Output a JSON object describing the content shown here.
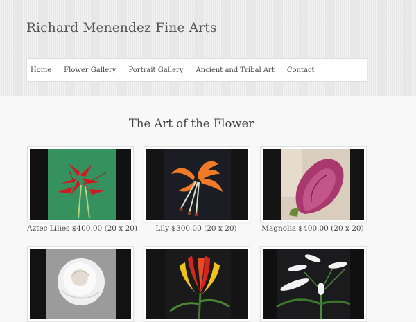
{
  "site": {
    "title": "Richard Menendez Fine Arts"
  },
  "nav": {
    "items": [
      {
        "label": "Home"
      },
      {
        "label": "Flower Gallery"
      },
      {
        "label": "Portrait Gallery"
      },
      {
        "label": "Ancient and Tribal Art"
      },
      {
        "label": "Contact"
      }
    ]
  },
  "page": {
    "heading": "The Art of the Flower"
  },
  "gallery": {
    "items": [
      {
        "caption": "Aztec Lilies $400.00 (20 x 20)",
        "image": "red-aztec-lilies-painting"
      },
      {
        "caption": "Lily $300.00 (20 x 20)",
        "image": "orange-lily-painting"
      },
      {
        "caption": "Magnolia $400.00 (20 x 20)",
        "image": "pink-magnolia-painting"
      },
      {
        "caption": "",
        "image": "white-rose-painting"
      },
      {
        "caption": "",
        "image": "red-yellow-lily-painting"
      },
      {
        "caption": "",
        "image": "white-lilies-painting"
      }
    ]
  }
}
